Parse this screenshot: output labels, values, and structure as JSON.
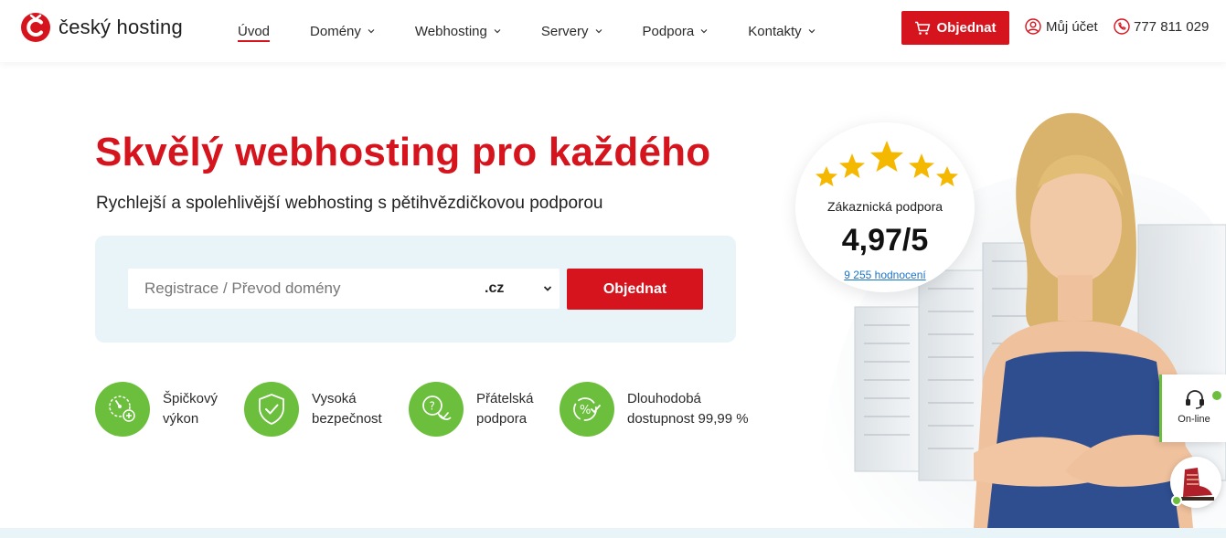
{
  "header": {
    "logo_text": "český hosting",
    "nav": [
      {
        "label": "Úvod",
        "active": true
      },
      {
        "label": "Domény"
      },
      {
        "label": "Webhosting"
      },
      {
        "label": "Servery"
      },
      {
        "label": "Podpora"
      },
      {
        "label": "Kontakty"
      }
    ],
    "order_label": "Objednat",
    "account_label": "Můj účet",
    "phone": "777 811 029"
  },
  "hero": {
    "title": "Skvělý webhosting pro každého",
    "subtitle": "Rychlejší a spolehlivější webhosting s pětihvězdičkovou podporou"
  },
  "search": {
    "placeholder": "Registrace / Převod domény",
    "tld": ".cz",
    "button_label": "Objednat"
  },
  "features": [
    {
      "icon": "speed-icon",
      "label": "Špičkový\nvýkon"
    },
    {
      "icon": "shield-icon",
      "label": "Vysoká\nbezpečnost"
    },
    {
      "icon": "chat-icon",
      "label": "Přátelská\npodpora"
    },
    {
      "icon": "uptime-icon",
      "label": "Dlouhodobá\ndostupnost 99,99 %"
    }
  ],
  "rating": {
    "label": "Zákaznická podpora",
    "value": "4,97/5",
    "reviews_link": "9 255 hodnocení",
    "stars": 5
  },
  "widgets": {
    "online_label": "On-line"
  },
  "colors": {
    "brand_red": "#d6141d",
    "accent_green": "#6bbf3c",
    "panel_bg": "#e8f4f7",
    "star_yellow": "#f5b800"
  }
}
